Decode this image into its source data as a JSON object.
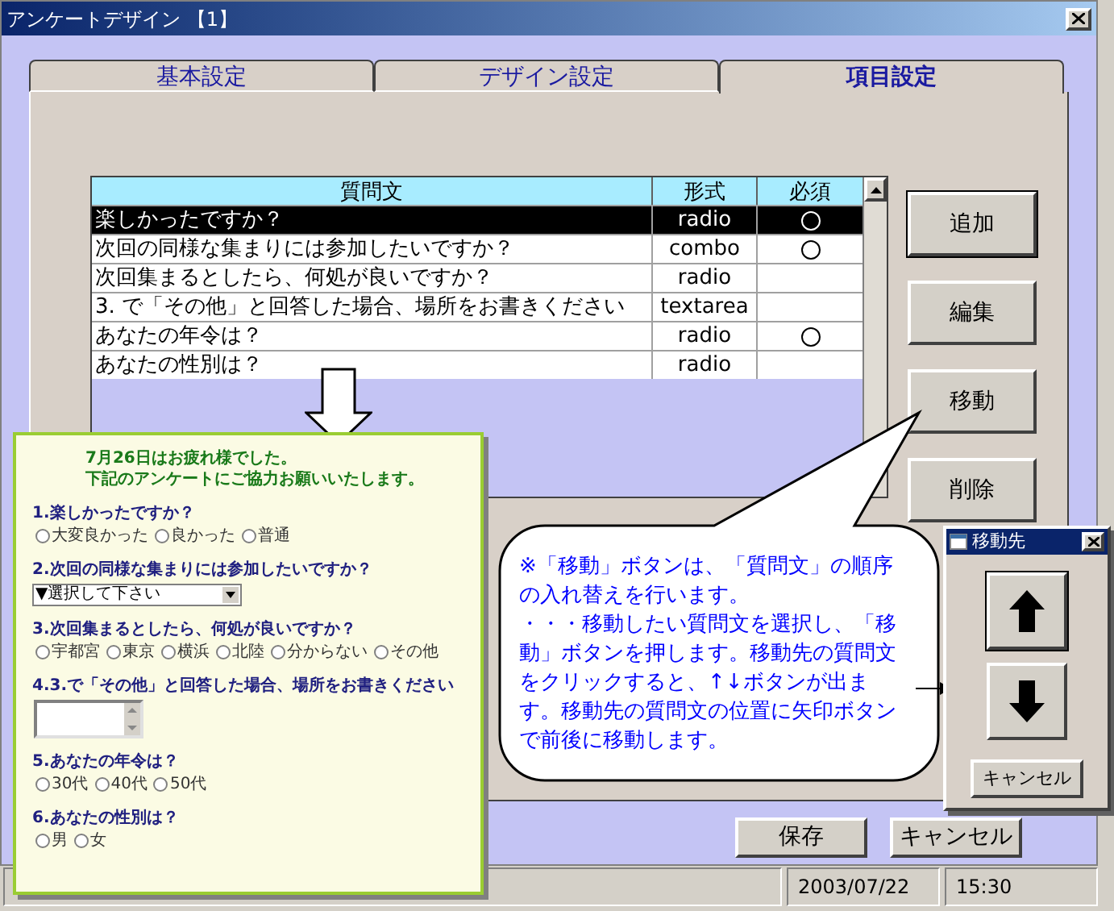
{
  "window": {
    "title": "アンケートデザイン 【1】"
  },
  "tabs": [
    {
      "label": "基本設定",
      "selected": false
    },
    {
      "label": "デザイン設定",
      "selected": false
    },
    {
      "label": "項目設定",
      "selected": true
    }
  ],
  "table": {
    "columns": [
      "質問文",
      "形式",
      "必須"
    ],
    "rows": [
      {
        "question": "楽しかったですか？",
        "type": "radio",
        "required": true,
        "selected": true
      },
      {
        "question": "次回の同様な集まりには参加したいですか？",
        "type": "combo",
        "required": true,
        "selected": false
      },
      {
        "question": "次回集まるとしたら、何処が良いですか？",
        "type": "radio",
        "required": false,
        "selected": false
      },
      {
        "question": "3. で「その他」と回答した場合、場所をお書きください",
        "type": "textarea",
        "required": false,
        "selected": false
      },
      {
        "question": "あなたの年令は？",
        "type": "radio",
        "required": true,
        "selected": false
      },
      {
        "question": "あなたの性別は？",
        "type": "radio",
        "required": false,
        "selected": false
      }
    ]
  },
  "side_buttons": [
    "追加",
    "編集",
    "移動",
    "削除"
  ],
  "bottom_buttons": [
    "保存",
    "キャンセル"
  ],
  "status_bar": [
    "2003/07/22",
    "15:30"
  ],
  "preview": {
    "greeting": [
      "7月26日はお疲れ様でした。",
      "下記のアンケートにご協力お願いいたします。"
    ],
    "questions": [
      {
        "kind": "radio",
        "label": "1.楽しかったですか？",
        "options": [
          {
            "label": "大変良かった",
            "selected": false
          },
          {
            "label": "良かった",
            "selected": false
          },
          {
            "label": "普通",
            "selected": false
          }
        ]
      },
      {
        "kind": "combo",
        "label": "2.次回の同様な集まりには参加したいですか？",
        "value": "▼選択して下さい"
      },
      {
        "kind": "radio",
        "label": "3.次回集まるとしたら、何処が良いですか？",
        "options": [
          {
            "label": "宇都宮",
            "selected": false
          },
          {
            "label": "東京",
            "selected": false
          },
          {
            "label": "横浜",
            "selected": false
          },
          {
            "label": "北陸",
            "selected": false
          },
          {
            "label": "分からない",
            "selected": false
          },
          {
            "label": "その他",
            "selected": false
          }
        ]
      },
      {
        "kind": "textarea",
        "label": "4.3.で「その他」と回答した場合、場所をお書きください"
      },
      {
        "kind": "radio",
        "label": "5.あなたの年令は？",
        "options": [
          {
            "label": "30代",
            "selected": false
          },
          {
            "label": "40代",
            "selected": false
          },
          {
            "label": "50代",
            "selected": false
          }
        ]
      },
      {
        "kind": "radio",
        "label": "6.あなたの性別は？",
        "options": [
          {
            "label": "男",
            "selected": false
          },
          {
            "label": "女",
            "selected": false
          }
        ]
      }
    ]
  },
  "callout": {
    "paragraphs": [
      "※「移動」ボタンは、「質問文」の順序の入れ替えを行います。",
      "・・・移動したい質問文を選択し、「移動」ボタンを押します。移動先の質問文をクリックすると、↑↓ボタンが出ます。移動先の質問文の位置に矢印ボタンで前後に移動します。"
    ]
  },
  "move_dialog": {
    "title": "移動先",
    "cancel": "キャンセル"
  }
}
